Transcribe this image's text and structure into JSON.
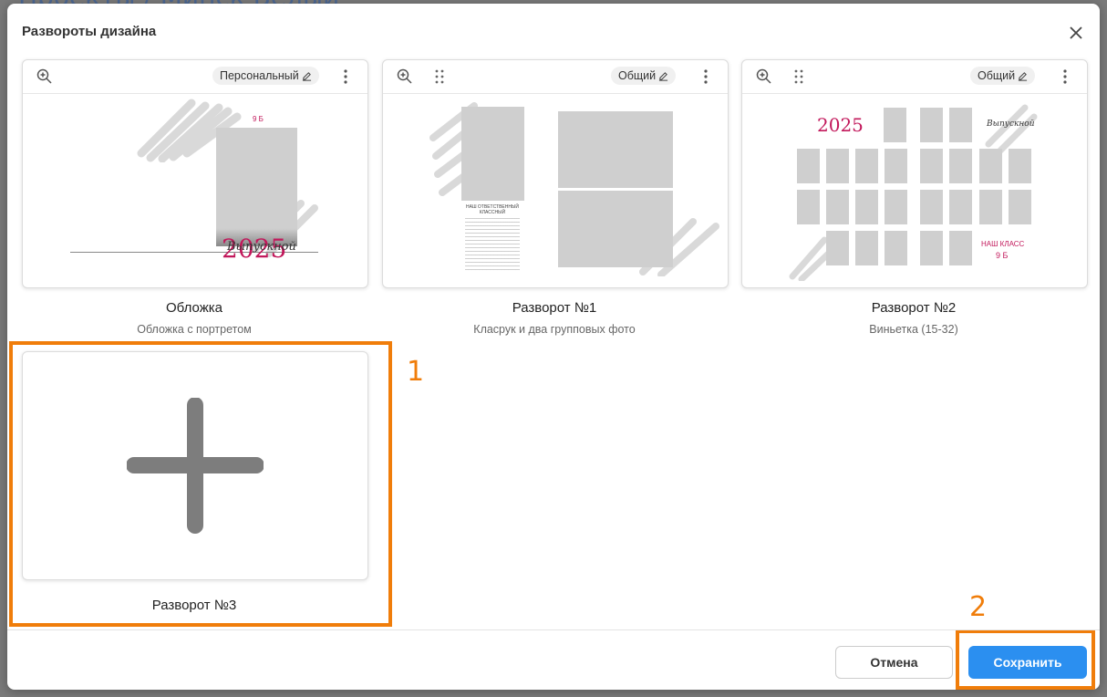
{
  "background": {
    "title": "Проекты / Минск Белый"
  },
  "modal": {
    "title": "Развороты дизайна",
    "close_icon": "close-icon",
    "cards": [
      {
        "name": "Обложка",
        "subtitle": "Обложка с портретом",
        "chip": "Персональный",
        "preview": {
          "top_text": "9 Б",
          "year": "2025",
          "script_text": "Выпускной"
        }
      },
      {
        "name": "Разворот №1",
        "subtitle": "Класрук и два групповых фото",
        "chip": "Общий",
        "preview": {
          "heading": "НАШ ОТВЕТСТВЕННЫЙ КЛАССНЫЙ"
        }
      },
      {
        "name": "Разворот №2",
        "subtitle": "Виньетка (15-32)",
        "chip": "Общий",
        "preview": {
          "year": "2025",
          "script_text": "Выпускной",
          "class_text": "НАШ КЛАСС",
          "class_name": "9 Б"
        }
      }
    ],
    "add_card": {
      "name": "Разворот №3",
      "icon": "plus-icon"
    },
    "buttons": {
      "cancel": "Отмена",
      "save": "Сохранить"
    }
  },
  "annotations": {
    "first": "1",
    "second": "2"
  },
  "colors": {
    "accent": "#2b8ff0",
    "highlight": "#f07d0a",
    "year_pink": "#c2185b"
  }
}
